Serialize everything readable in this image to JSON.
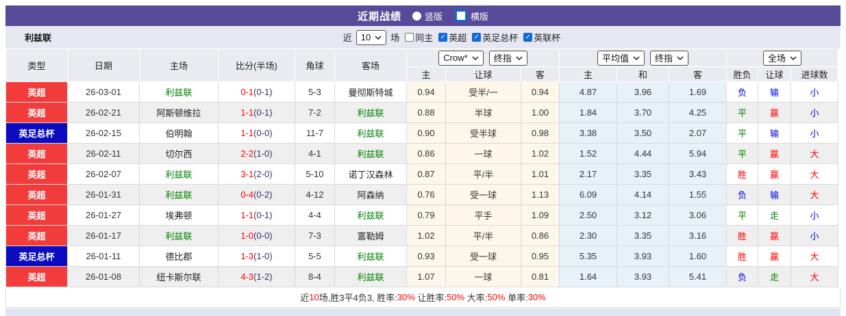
{
  "colors": {
    "red": "#ff0000",
    "blue": "#0000e0",
    "green": "#008000",
    "navy": "#333366",
    "dark": "#333333",
    "badge_red": "#f23c3c",
    "badge_blue": "#0b0bc0",
    "accent_purple": "#574a99",
    "check_blue": "#1569d6",
    "avg_col_bg": "#e7f2f8",
    "odds_col_bg": "#fcf7ea"
  },
  "title_bar": {
    "title": "近期战绩",
    "radios": [
      {
        "label": "竖版",
        "selected": false
      },
      {
        "label": "横版",
        "selected": true
      }
    ]
  },
  "filter_bar": {
    "team": "利兹联",
    "recent_label": "近",
    "recent_value": "10",
    "games_label": "场",
    "checkboxes": [
      {
        "label": "同主",
        "checked": false
      },
      {
        "label": "英超",
        "checked": true
      },
      {
        "label": "英足总杯",
        "checked": true
      },
      {
        "label": "英联杯",
        "checked": true
      }
    ]
  },
  "table": {
    "static_headers": [
      "类型",
      "日期",
      "主场",
      "比分(半场)",
      "角球",
      "客场"
    ],
    "groups": [
      {
        "selects": [
          "Crow*",
          "终指"
        ],
        "subheaders": [
          "主",
          "让球",
          "客"
        ]
      },
      {
        "selects": [
          "平均值",
          "终指"
        ],
        "subheaders": [
          "主",
          "和",
          "客"
        ]
      },
      {
        "selects": [
          "全场"
        ],
        "subheaders": [
          "胜负",
          "让球",
          "进球数"
        ]
      }
    ],
    "rows": [
      {
        "type": "英超",
        "type_color": "red",
        "date": "26-03-01",
        "home": "利兹联",
        "home_green": true,
        "score": "0-1",
        "half": "(0-1)",
        "corner": "5-3",
        "away": "曼彻斯特城",
        "away_green": false,
        "odds": [
          "0.94",
          "受半/一",
          "0.94"
        ],
        "avg": [
          "4.87",
          "3.96",
          "1.69"
        ],
        "res": [
          [
            "负",
            "blue"
          ],
          [
            "输",
            "blue"
          ],
          [
            "小",
            "blue"
          ]
        ]
      },
      {
        "type": "英超",
        "type_color": "red",
        "date": "26-02-21",
        "home": "阿斯顿维拉",
        "home_green": false,
        "score": "1-1",
        "half": "(0-1)",
        "corner": "7-2",
        "away": "利兹联",
        "away_green": true,
        "odds": [
          "0.88",
          "半球",
          "1.00"
        ],
        "avg": [
          "1.84",
          "3.70",
          "4.25"
        ],
        "res": [
          [
            "平",
            "green"
          ],
          [
            "赢",
            "red"
          ],
          [
            "小",
            "blue"
          ]
        ]
      },
      {
        "type": "英足总杯",
        "type_color": "blue",
        "date": "26-02-15",
        "home": "伯明翰",
        "home_green": false,
        "score": "1-1",
        "half": "(0-0)",
        "corner": "11-7",
        "away": "利兹联",
        "away_green": true,
        "odds": [
          "0.90",
          "受半球",
          "0.98"
        ],
        "avg": [
          "3.38",
          "3.50",
          "2.07"
        ],
        "res": [
          [
            "平",
            "green"
          ],
          [
            "输",
            "blue"
          ],
          [
            "小",
            "blue"
          ]
        ]
      },
      {
        "type": "英超",
        "type_color": "red",
        "date": "26-02-11",
        "home": "切尔西",
        "home_green": false,
        "score": "2-2",
        "half": "(1-0)",
        "corner": "4-1",
        "away": "利兹联",
        "away_green": true,
        "odds": [
          "0.86",
          "一球",
          "1.02"
        ],
        "avg": [
          "1.52",
          "4.44",
          "5.94"
        ],
        "res": [
          [
            "平",
            "green"
          ],
          [
            "赢",
            "red"
          ],
          [
            "大",
            "red"
          ]
        ]
      },
      {
        "type": "英超",
        "type_color": "red",
        "date": "26-02-07",
        "home": "利兹联",
        "home_green": true,
        "score": "3-1",
        "half": "(2-0)",
        "corner": "5-10",
        "away": "诺丁汉森林",
        "away_green": false,
        "odds": [
          "0.87",
          "平/半",
          "1.01"
        ],
        "avg": [
          "2.17",
          "3.35",
          "3.43"
        ],
        "res": [
          [
            "胜",
            "red"
          ],
          [
            "赢",
            "red"
          ],
          [
            "大",
            "red"
          ]
        ]
      },
      {
        "type": "英超",
        "type_color": "red",
        "date": "26-01-31",
        "home": "利兹联",
        "home_green": true,
        "score": "0-4",
        "half": "(0-2)",
        "corner": "4-12",
        "away": "阿森纳",
        "away_green": false,
        "odds": [
          "0.76",
          "受一球",
          "1.13"
        ],
        "avg": [
          "6.09",
          "4.14",
          "1.55"
        ],
        "res": [
          [
            "负",
            "blue"
          ],
          [
            "输",
            "blue"
          ],
          [
            "大",
            "red"
          ]
        ]
      },
      {
        "type": "英超",
        "type_color": "red",
        "date": "26-01-27",
        "home": "埃弗顿",
        "home_green": false,
        "score": "1-1",
        "half": "(0-1)",
        "corner": "4-4",
        "away": "利兹联",
        "away_green": true,
        "odds": [
          "0.79",
          "平手",
          "1.09"
        ],
        "avg": [
          "2.50",
          "3.12",
          "3.06"
        ],
        "res": [
          [
            "平",
            "green"
          ],
          [
            "走",
            "green"
          ],
          [
            "小",
            "blue"
          ]
        ]
      },
      {
        "type": "英超",
        "type_color": "red",
        "date": "26-01-17",
        "home": "利兹联",
        "home_green": true,
        "score": "1-0",
        "half": "(0-0)",
        "corner": "7-3",
        "away": "富勒姆",
        "away_green": false,
        "odds": [
          "1.02",
          "平/半",
          "0.86"
        ],
        "avg": [
          "2.30",
          "3.35",
          "3.16"
        ],
        "res": [
          [
            "胜",
            "red"
          ],
          [
            "赢",
            "red"
          ],
          [
            "小",
            "blue"
          ]
        ]
      },
      {
        "type": "英足总杯",
        "type_color": "blue",
        "date": "26-01-11",
        "home": "德比郡",
        "home_green": false,
        "score": "1-3",
        "half": "(1-0)",
        "corner": "5-5",
        "away": "利兹联",
        "away_green": true,
        "odds": [
          "0.93",
          "受一球",
          "0.95"
        ],
        "avg": [
          "5.35",
          "3.93",
          "1.60"
        ],
        "res": [
          [
            "胜",
            "red"
          ],
          [
            "赢",
            "red"
          ],
          [
            "大",
            "red"
          ]
        ]
      },
      {
        "type": "英超",
        "type_color": "red",
        "date": "26-01-08",
        "home": "纽卡斯尔联",
        "home_green": false,
        "score": "4-3",
        "half": "(1-2)",
        "corner": "8-4",
        "away": "利兹联",
        "away_green": true,
        "odds": [
          "1.07",
          "一球",
          "0.81"
        ],
        "avg": [
          "1.64",
          "3.93",
          "5.41"
        ],
        "res": [
          [
            "负",
            "blue"
          ],
          [
            "走",
            "green"
          ],
          [
            "大",
            "red"
          ]
        ]
      }
    ]
  },
  "footer": {
    "segments": [
      [
        "近",
        "dark"
      ],
      [
        "10",
        "red"
      ],
      [
        "场,胜3平4负3, 胜率:",
        "dark"
      ],
      [
        "30%",
        "red"
      ],
      [
        " 让胜率:",
        "dark"
      ],
      [
        "50%",
        "red"
      ],
      [
        " 大率:",
        "dark"
      ],
      [
        "50%",
        "red"
      ],
      [
        " 单率:",
        "dark"
      ],
      [
        "30%",
        "red"
      ]
    ]
  }
}
